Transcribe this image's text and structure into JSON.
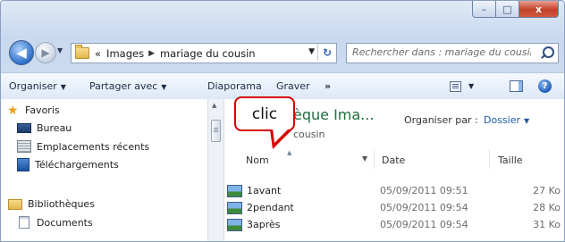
{
  "window": {
    "caption": {
      "minimize": "–",
      "maximize": "□",
      "close": "x"
    }
  },
  "address": {
    "prefix": "«",
    "crumbs": [
      "Images",
      "mariage du cousin"
    ],
    "search_placeholder": "Rechercher dans : mariage du cousin"
  },
  "toolbar": {
    "organize": "Organiser",
    "share": "Partager avec",
    "slideshow": "Diaporama",
    "burn": "Graver",
    "more": "»",
    "help": "?"
  },
  "nav": {
    "favorites": "Favoris",
    "desktop": "Bureau",
    "recent": "Emplacements récents",
    "downloads": "Téléchargements",
    "libraries": "Bibliothèques",
    "documents": "Documents"
  },
  "library": {
    "title": "èque Ima...",
    "subtitle": "cousin",
    "arrange_label": "Organiser par :",
    "arrange_value": "Dossier"
  },
  "columns": {
    "name": "Nom",
    "date": "Date",
    "size": "Taille"
  },
  "files": [
    {
      "name": "1avant",
      "date": "05/09/2011 09:51",
      "size": "27 Ko"
    },
    {
      "name": "2pendant",
      "date": "05/09/2011 09:54",
      "size": "28 Ko"
    },
    {
      "name": "3après",
      "date": "05/09/2011 09:54",
      "size": "31 Ko"
    }
  ],
  "callout": {
    "text": "clic",
    "border_color": "#d40000"
  },
  "icons": {
    "back": "back-arrow-icon",
    "forward": "forward-arrow-icon",
    "folder": "folder-icon",
    "refresh": "refresh-icon",
    "search": "search-icon",
    "views": "views-icon",
    "preview_pane": "preview-pane-icon",
    "help": "help-icon",
    "favorites": "star-icon",
    "image": "image-file-icon"
  }
}
